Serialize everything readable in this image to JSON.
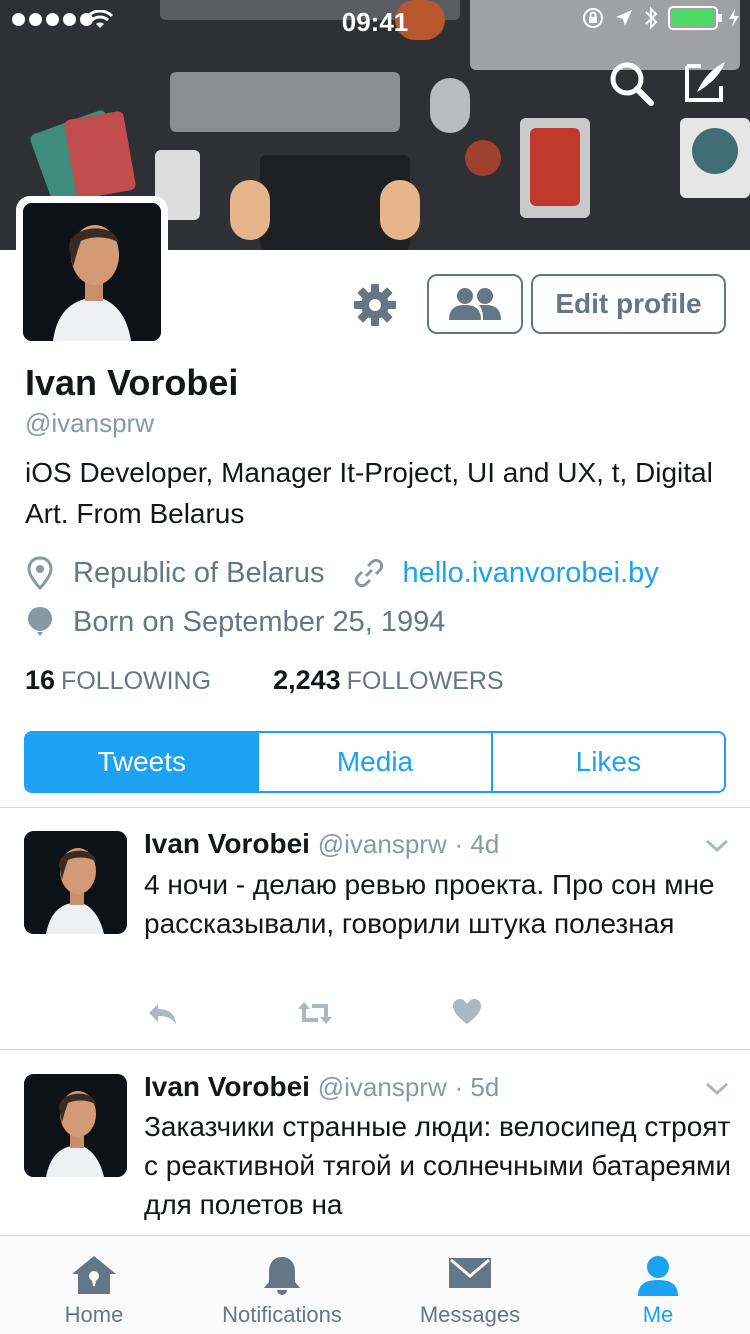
{
  "status_bar": {
    "time": "09:41"
  },
  "profile": {
    "name": "Ivan Vorobei",
    "handle": "@ivansprw",
    "bio": "iOS Developer, Manager It-Project, UI and UX, t, Digital Art. From Belarus",
    "location": "Republic of Belarus",
    "website": "hello.ivanvorobei.by",
    "birthday": "Born on September 25, 1994",
    "following_count": "16",
    "following_label": "FOLLOWING",
    "followers_count": "2,243",
    "followers_label": "FOLLOWERS",
    "edit_label": "Edit profile"
  },
  "tabs": [
    {
      "label": "Tweets",
      "active": true
    },
    {
      "label": "Media",
      "active": false
    },
    {
      "label": "Likes",
      "active": false
    }
  ],
  "tweets": [
    {
      "author": "Ivan Vorobei",
      "handle": "@ivansprw",
      "age": "· 4d",
      "text": "4 ночи - делаю ревью проекта. Про сон мне рассказывали, говорили штука полезная"
    },
    {
      "author": "Ivan Vorobei",
      "handle": "@ivansprw",
      "age": "· 5d",
      "text": "Заказчики странные люди: велосипед строят с реактивной тягой и солнечными батареями для полетов на"
    }
  ],
  "tabbar": [
    {
      "label": "Home",
      "icon": "home-icon",
      "active": false
    },
    {
      "label": "Notifications",
      "icon": "bell-icon",
      "active": false
    },
    {
      "label": "Messages",
      "icon": "envelope-icon",
      "active": false
    },
    {
      "label": "Me",
      "icon": "person-icon",
      "active": true
    }
  ],
  "colors": {
    "accent": "#1da1f2",
    "muted": "#657786",
    "banner": "#2f3033"
  }
}
